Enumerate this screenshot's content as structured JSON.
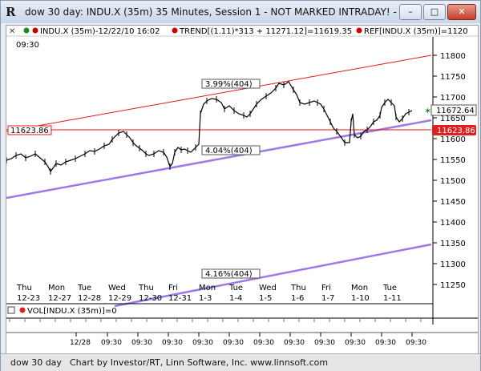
{
  "window": {
    "title": "dow 30 day: INDU.X (35m) 35 Minutes, Session 1 - NOT MARKED INTRADAY! - IN...",
    "icon": "r-app-icon",
    "buttons": {
      "minimize": "–",
      "maximize": "□",
      "close": "✕"
    }
  },
  "legend": {
    "main": "INDU.X (35m)-12/22/10 16:02",
    "trend": "TREND[(1.11)*313 + 11271.12]=11619.35",
    "ref": "REF[INDU.X (35m)]=1120",
    "time": "09:30",
    "trend_dot_color": "#d00000",
    "ref_dot_color": "#d00000",
    "main_dot_color": "#1a8a1a"
  },
  "price_axis": {
    "ticks": [
      "11800",
      "11750",
      "11700",
      "11650",
      "11600",
      "11550",
      "11500",
      "11450",
      "11400",
      "11350",
      "11300",
      "11250"
    ],
    "last_price_badge": "11672.64",
    "last_price_color": "#1a8a1a",
    "ref_badge": "11623.86",
    "ref_color": "#e02020"
  },
  "annotations": {
    "ref_label": "11623.86",
    "upper_channel": "3.99%(404)",
    "mid_channel": "4.04%(404)",
    "lower_channel": "4.16%(404)"
  },
  "days": [
    {
      "dow": "Thu",
      "date": "12-23"
    },
    {
      "dow": "Mon",
      "date": "12-27"
    },
    {
      "dow": "Tue",
      "date": "12-28"
    },
    {
      "dow": "Wed",
      "date": "12-29"
    },
    {
      "dow": "Thu",
      "date": "12-30"
    },
    {
      "dow": "Fri",
      "date": "12-31"
    },
    {
      "dow": "Mon",
      "date": "1-3"
    },
    {
      "dow": "Tue",
      "date": "1-4"
    },
    {
      "dow": "Wed",
      "date": "1-5"
    },
    {
      "dow": "Thu",
      "date": "1-6"
    },
    {
      "dow": "Fri",
      "date": "1-7"
    },
    {
      "dow": "Mon",
      "date": "1-10"
    },
    {
      "dow": "Tue",
      "date": "1-11"
    }
  ],
  "volume_pane": {
    "label": "VOL[INDU.X (35m)]=0"
  },
  "time_axis": {
    "labels": [
      "12/28",
      "09:30",
      "09:30",
      "09:30",
      "09:30",
      "09:30",
      "09:30",
      "09:30",
      "09:30",
      "09:30",
      "09:30",
      "09:30"
    ]
  },
  "status": {
    "left": "dow 30 day",
    "credit": "Chart by Investor/RT, Linn Software, Inc. www.linnsoft.com"
  }
}
